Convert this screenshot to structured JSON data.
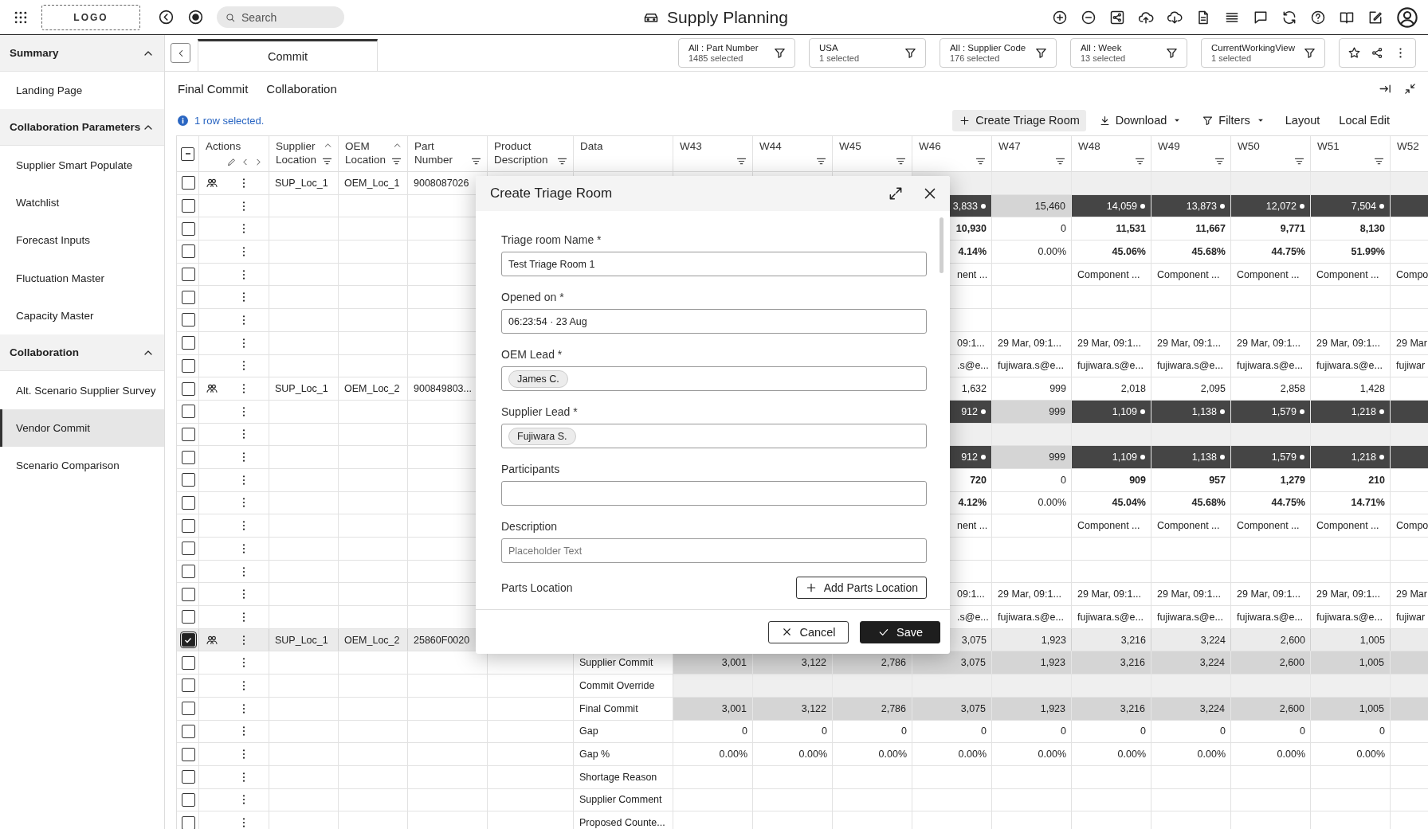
{
  "topbar": {
    "logo": "LOGO",
    "search": {
      "placeholder": "Search"
    },
    "title": "Supply Planning"
  },
  "sidebar": {
    "sections": [
      {
        "title": "Summary",
        "expanded": true,
        "items": [
          {
            "label": "Landing Page",
            "selected": false
          }
        ]
      },
      {
        "title": "Collaboration Parameters",
        "expanded": true,
        "items": [
          {
            "label": "Supplier Smart Populate",
            "selected": false
          },
          {
            "label": "Watchlist",
            "selected": false
          },
          {
            "label": "Forecast Inputs",
            "selected": false
          },
          {
            "label": "Fluctuation Master",
            "selected": false
          },
          {
            "label": "Capacity Master",
            "selected": false
          }
        ]
      },
      {
        "title": "Collaboration",
        "expanded": true,
        "items": [
          {
            "label": "Alt. Scenario Supplier Survey",
            "selected": false
          },
          {
            "label": "Vendor Commit",
            "selected": true
          },
          {
            "label": "Scenario Comparison",
            "selected": false
          }
        ]
      }
    ]
  },
  "tabs": [
    {
      "label": "Commit",
      "selected": true
    }
  ],
  "filters": [
    {
      "label": "All : Part Number",
      "count": "1485 selected"
    },
    {
      "label": "USA",
      "count": "1 selected"
    },
    {
      "label": "All : Supplier Code",
      "count": "176 selected"
    },
    {
      "label": "All : Week",
      "count": "13 selected"
    },
    {
      "label": "CurrentWorkingView",
      "count": "1 selected"
    }
  ],
  "views": [
    "Final Commit",
    "Collaboration"
  ],
  "selection_info": "1 row selected.",
  "toolbar": [
    {
      "label": "Create Triage Room",
      "kind": "add",
      "highlighted": true
    },
    {
      "label": "Download",
      "kind": "download",
      "highlighted": false
    },
    {
      "label": "Filters",
      "kind": "filter",
      "highlighted": false
    },
    {
      "label": "Layout",
      "kind": "plain",
      "highlighted": false
    },
    {
      "label": "Local Edit",
      "kind": "plain",
      "highlighted": false
    }
  ],
  "table": {
    "select_all": {
      "partial": true
    },
    "columns": [
      {
        "label": "Actions",
        "kind": "actions"
      },
      {
        "label": "Supplier Location",
        "kind": "field",
        "sorted": true,
        "filterable": true
      },
      {
        "label": "OEM Location",
        "kind": "field",
        "sorted": true,
        "filterable": true
      },
      {
        "label": "Part Number",
        "kind": "field",
        "sorted": false,
        "filterable": true
      },
      {
        "label": "Product Description",
        "kind": "field",
        "sorted": false,
        "filterable": true
      },
      {
        "label": "Data",
        "kind": "field",
        "sorted": false,
        "filterable": false
      }
    ],
    "weeks": [
      {
        "label": "W43",
        "filterable": true
      },
      {
        "label": "W44",
        "filterable": true
      },
      {
        "label": "W45",
        "filterable": true
      },
      {
        "label": "W46",
        "filterable": true
      },
      {
        "label": "W47",
        "filterable": true
      },
      {
        "label": "W48",
        "filterable": true
      },
      {
        "label": "W49",
        "filterable": true
      },
      {
        "label": "W50",
        "filterable": true
      },
      {
        "label": "W51",
        "filterable": true
      },
      {
        "label": "W52",
        "filterable": false
      }
    ],
    "rows": [
      {
        "kind": "tinted",
        "parent": true,
        "checked": false,
        "supplier_location": "SUP_Loc_1",
        "oem_location": "OEM_Loc_1",
        "part_number": "9008087026"
      },
      {
        "kind": "dark",
        "parent": false,
        "checked": false,
        "flagged": true,
        "weeks": [
          "3,833",
          {
            "text": "15,460",
            "kind": "shaded"
          },
          "14,059",
          "13,873",
          "12,072",
          "7,504"
        ]
      },
      {
        "kind": "bold",
        "parent": false,
        "checked": false,
        "weeks": [
          "10,930",
          {
            "text": "0",
            "kind": "plain"
          },
          "11,531",
          "11,667",
          "9,771",
          "8,130"
        ]
      },
      {
        "kind": "bold",
        "parent": false,
        "checked": false,
        "weeks": [
          "4.14%",
          {
            "text": "0.00%",
            "kind": "plain"
          },
          "45.06%",
          "45.68%",
          "44.75%",
          "51.99%"
        ]
      },
      {
        "kind": "text",
        "parent": false,
        "checked": false,
        "weeks": [
          "nent ...",
          {
            "kind": "blank"
          },
          "Component ...",
          "Component ...",
          "Component ...",
          "Component ...",
          "Compo"
        ]
      },
      {
        "kind": "plain",
        "parent": false,
        "checked": false
      },
      {
        "kind": "plain",
        "parent": false,
        "checked": false
      },
      {
        "kind": "text",
        "parent": false,
        "checked": false,
        "weeks": [
          "09:1...",
          "29 Mar, 09:1...",
          "29 Mar, 09:1...",
          "29 Mar, 09:1...",
          "29 Mar, 09:1...",
          "29 Mar, 09:1...",
          "29 Mar"
        ]
      },
      {
        "kind": "text",
        "parent": false,
        "checked": false,
        "weeks": [
          ".s@e...",
          "fujiwara.s@e...",
          "fujiwara.s@e...",
          "fujiwara.s@e...",
          "fujiwara.s@e...",
          "fujiwara.s@e...",
          "fujiwar"
        ]
      },
      {
        "kind": "plain",
        "parent": true,
        "checked": false,
        "supplier_location": "SUP_Loc_1",
        "oem_location": "OEM_Loc_2",
        "part_number": "900849803...",
        "weeks": [
          "1,632",
          "999",
          "2,018",
          "2,095",
          "2,858",
          "1,428"
        ]
      },
      {
        "kind": "dark",
        "parent": false,
        "checked": false,
        "flagged": true,
        "weeks": [
          "912",
          {
            "text": "999",
            "kind": "shaded"
          },
          "1,109",
          "1,138",
          "1,579",
          "1,218"
        ]
      },
      {
        "kind": "tinted",
        "parent": false,
        "checked": false
      },
      {
        "kind": "dark",
        "parent": false,
        "checked": false,
        "flagged": true,
        "weeks": [
          "912",
          {
            "text": "999",
            "kind": "shaded"
          },
          "1,109",
          "1,138",
          "1,579",
          "1,218"
        ]
      },
      {
        "kind": "bold",
        "parent": false,
        "checked": false,
        "weeks": [
          "720",
          {
            "text": "0",
            "kind": "plain"
          },
          "909",
          "957",
          "1,279",
          "210"
        ]
      },
      {
        "kind": "bold",
        "parent": false,
        "checked": false,
        "weeks": [
          "4.12%",
          {
            "text": "0.00%",
            "kind": "plain"
          },
          "45.04%",
          "45.68%",
          "44.75%",
          "14.71%"
        ]
      },
      {
        "kind": "text",
        "parent": false,
        "checked": false,
        "weeks": [
          "nent ...",
          {
            "kind": "blank"
          },
          "Component ...",
          "Component ...",
          "Component ...",
          "Component ...",
          "Compo"
        ]
      },
      {
        "kind": "plain",
        "parent": false,
        "checked": false
      },
      {
        "kind": "plain",
        "parent": false,
        "checked": false
      },
      {
        "kind": "text",
        "parent": false,
        "checked": false,
        "weeks": [
          "09:1...",
          "29 Mar, 09:1...",
          "29 Mar, 09:1...",
          "29 Mar, 09:1...",
          "29 Mar, 09:1...",
          "29 Mar, 09:1...",
          "29 Mar"
        ]
      },
      {
        "kind": "text",
        "parent": false,
        "checked": false,
        "weeks": [
          ".s@e...",
          "fujiwara.s@e...",
          "fujiwara.s@e...",
          "fujiwara.s@e...",
          "fujiwara.s@e...",
          "fujiwara.s@e...",
          "fujiwar"
        ]
      },
      {
        "kind": "plain",
        "parent": true,
        "checked": true,
        "supplier_location": "SUP_Loc_1",
        "oem_location": "OEM_Loc_2",
        "part_number": "25860F0020",
        "weeks": [
          "3,075",
          "1,923",
          "3,216",
          "3,224",
          "2,600",
          "1,005"
        ]
      },
      {
        "kind": "shaded",
        "parent": false,
        "checked": false,
        "data": "Supplier Commit",
        "weeks": [
          "3,001",
          "3,122",
          "2,786",
          "3,075",
          "1,923",
          "3,216",
          "3,224",
          "2,600",
          "1,005"
        ]
      },
      {
        "kind": "tinted",
        "parent": false,
        "checked": false,
        "data": "Commit Override"
      },
      {
        "kind": "shaded",
        "parent": false,
        "checked": false,
        "data": "Final Commit",
        "weeks": [
          "3,001",
          "3,122",
          "2,786",
          "3,075",
          "1,923",
          "3,216",
          "3,224",
          "2,600",
          "1,005"
        ]
      },
      {
        "kind": "plain",
        "parent": false,
        "checked": false,
        "data": "Gap",
        "weeks": [
          "0",
          "0",
          "0",
          "0",
          "0",
          "0",
          "0",
          "0",
          "0"
        ]
      },
      {
        "kind": "plain",
        "parent": false,
        "checked": false,
        "data": "Gap %",
        "weeks": [
          "0.00%",
          "0.00%",
          "0.00%",
          "0.00%",
          "0.00%",
          "0.00%",
          "0.00%",
          "0.00%",
          "0.00%"
        ]
      },
      {
        "kind": "plain",
        "parent": false,
        "checked": false,
        "data": "Shortage Reason"
      },
      {
        "kind": "plain",
        "parent": false,
        "checked": false,
        "data": "Supplier Comment"
      },
      {
        "kind": "plain",
        "parent": false,
        "checked": false,
        "data": "Proposed Counte..."
      }
    ]
  },
  "dialog": {
    "title": "Create Triage Room",
    "fields": [
      {
        "label": "Triage room Name *",
        "kind": "text",
        "value": "Test Triage Room 1"
      },
      {
        "label": "Opened on *",
        "kind": "text",
        "value": "06:23:54 · 23 Aug"
      },
      {
        "label": "OEM Lead *",
        "kind": "chips",
        "chips": [
          "James C."
        ]
      },
      {
        "label": "Supplier Lead *",
        "kind": "chips",
        "chips": [
          "Fujiwara S."
        ]
      },
      {
        "label": "Participants",
        "kind": "text"
      },
      {
        "label": "Description",
        "kind": "text",
        "placeholder": "Placeholder Text"
      }
    ],
    "section": {
      "label": "Parts Location",
      "action": "Add Parts Location"
    },
    "buttons": [
      {
        "label": "Cancel",
        "kind": "secondary"
      },
      {
        "label": "Save",
        "kind": "primary"
      }
    ]
  }
}
